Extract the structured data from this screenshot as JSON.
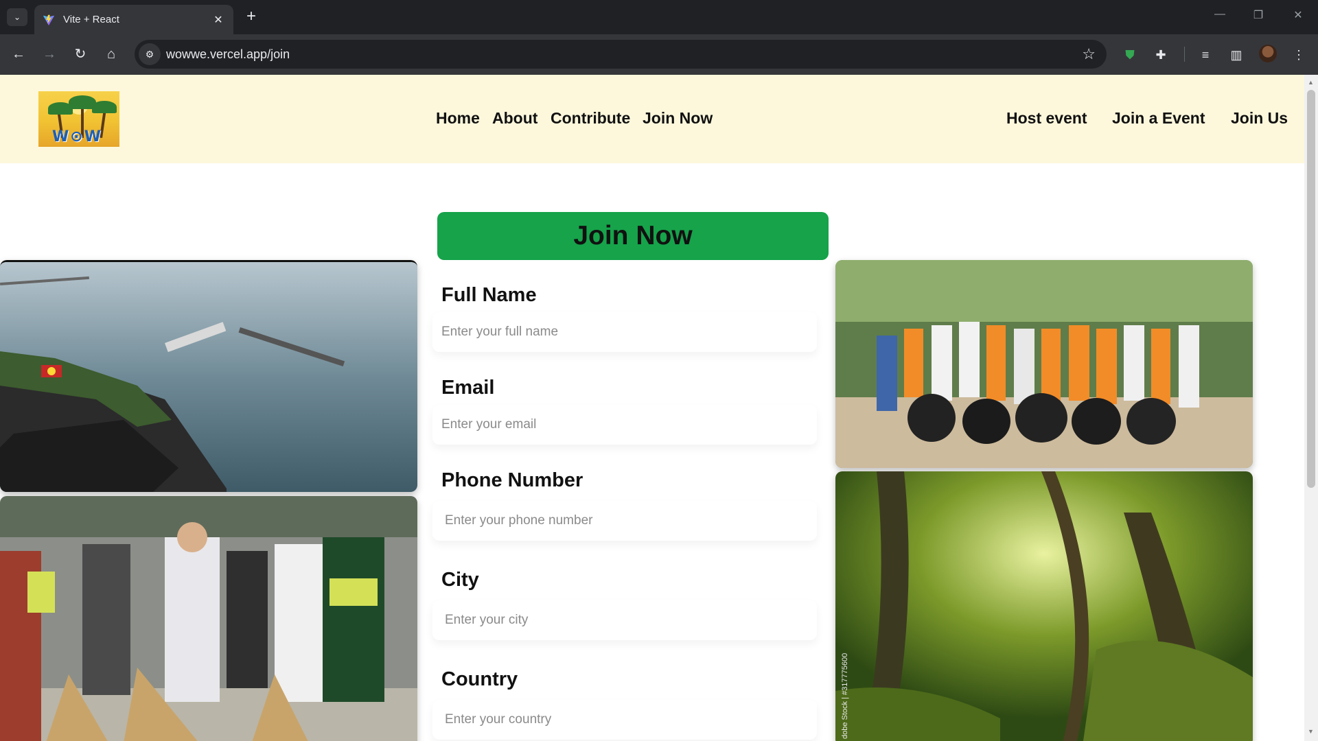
{
  "browser": {
    "tab_title": "Vite + React",
    "url": "wowwe.vercel.app/join"
  },
  "site": {
    "logo_text": "W⊙W",
    "nav_center": [
      "Home",
      "About",
      "Contribute",
      "Join Now"
    ],
    "nav_right": [
      "Host event",
      "Join a Event",
      "Join Us"
    ]
  },
  "page": {
    "heading": "Join Now",
    "fields": [
      {
        "label": "Full Name",
        "placeholder": "Enter your full name"
      },
      {
        "label": "Email",
        "placeholder": "Enter your email"
      },
      {
        "label": "Phone Number",
        "placeholder": "Enter your phone number"
      },
      {
        "label": "City",
        "placeholder": "Enter your city"
      },
      {
        "label": "Country",
        "placeholder": "Enter your country"
      }
    ],
    "image_watermark": "dobe Stock | #317775600"
  },
  "icons": {
    "tab_search": "chevron-down-icon",
    "close": "close-icon",
    "new_tab": "plus-icon",
    "back": "arrow-left-icon",
    "forward": "arrow-right-icon",
    "reload": "reload-icon",
    "home": "home-icon",
    "site_info": "tune-icon",
    "bookmark": "star-icon",
    "extension_shield": "shield-icon",
    "extensions": "puzzle-icon",
    "media": "media-queue-icon",
    "side_panel": "side-panel-icon",
    "menu": "kebab-menu-icon"
  },
  "colors": {
    "header_bg": "#fdf8dc",
    "join_button": "#16a34a",
    "chrome_dark": "#202124",
    "chrome_toolbar": "#35363a"
  }
}
